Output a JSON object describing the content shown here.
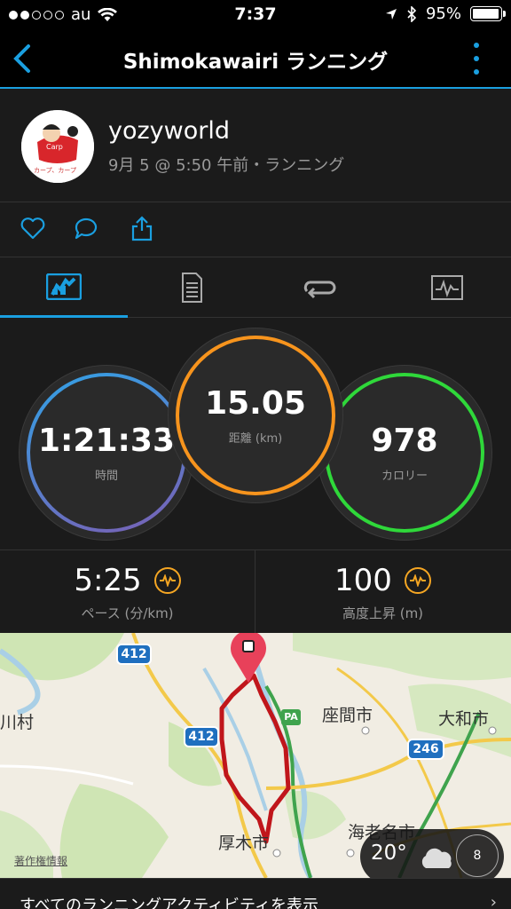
{
  "status": {
    "carrier": "au",
    "time": "7:37",
    "battery": "95%",
    "battery_level": 0.95,
    "signal_bars": 2
  },
  "nav": {
    "title": "Shimokawairi ランニング"
  },
  "profile": {
    "username": "yozyworld",
    "meta": "9月 5 @ 5:50 午前・ランニング"
  },
  "stats": {
    "time": {
      "value": "1:21:33",
      "label": "時間",
      "color": "#6e62b5"
    },
    "distance": {
      "value": "15.05",
      "label": "距離 (km)",
      "color": "#f7941d"
    },
    "calories": {
      "value": "978",
      "label": "カロリー",
      "color": "#2fd83a"
    }
  },
  "metrics": {
    "pace": {
      "value": "5:25",
      "label": "ペース (分/km)"
    },
    "elevation": {
      "value": "100",
      "label": "高度上昇 (m)"
    }
  },
  "map": {
    "labels": {
      "zama": "座間市",
      "yamato": "大和市",
      "atsugi": "厚木市",
      "ebina": "海老名市",
      "kawamura": "川村"
    },
    "road_badges": [
      "412",
      "412",
      "246",
      "PA"
    ],
    "copyright": "著作権情報",
    "weather": {
      "temp": "20°",
      "wind": "8"
    }
  },
  "footer": {
    "text": "すべてのランニングアクティビティを表示",
    "chevron": "›"
  },
  "colors": {
    "accent": "#1a9fe0",
    "route": "#c0161b",
    "activity_icon": "#f5a623"
  }
}
